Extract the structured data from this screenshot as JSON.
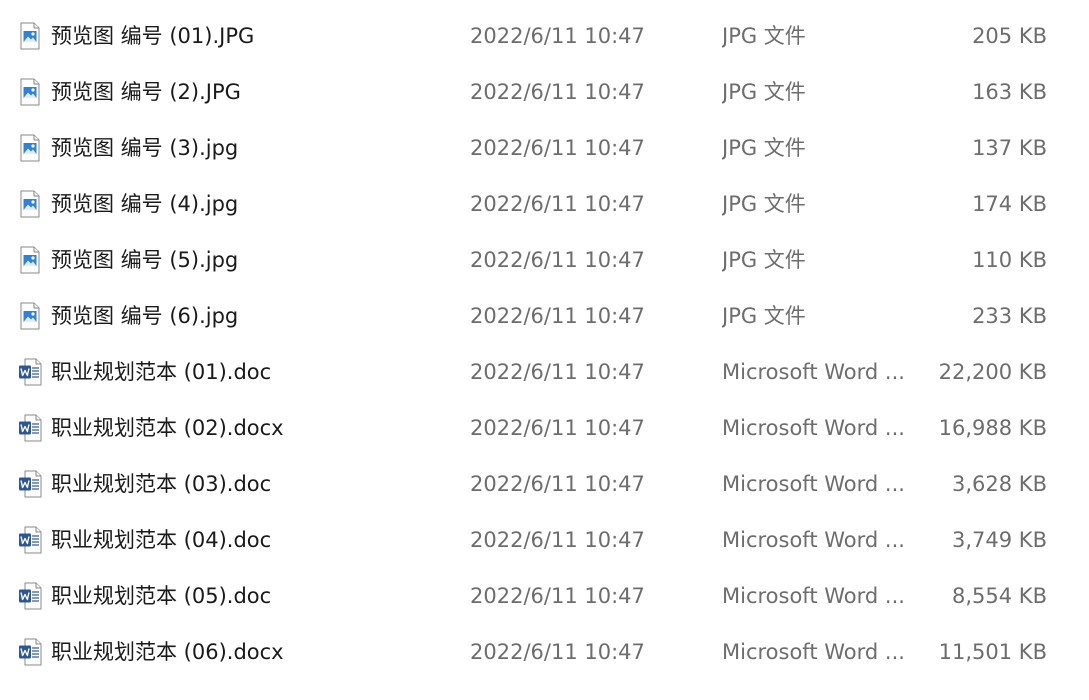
{
  "files": [
    {
      "name": "预览图 编号 (01).JPG",
      "modified": "2022/6/11 10:47",
      "type": "JPG 文件",
      "size": "205 KB",
      "icon": "image-file-icon"
    },
    {
      "name": "预览图 编号 (2).JPG",
      "modified": "2022/6/11 10:47",
      "type": "JPG 文件",
      "size": "163 KB",
      "icon": "image-file-icon"
    },
    {
      "name": "预览图 编号 (3).jpg",
      "modified": "2022/6/11 10:47",
      "type": "JPG 文件",
      "size": "137 KB",
      "icon": "image-file-icon"
    },
    {
      "name": "预览图 编号 (4).jpg",
      "modified": "2022/6/11 10:47",
      "type": "JPG 文件",
      "size": "174 KB",
      "icon": "image-file-icon"
    },
    {
      "name": "预览图 编号 (5).jpg",
      "modified": "2022/6/11 10:47",
      "type": "JPG 文件",
      "size": "110 KB",
      "icon": "image-file-icon"
    },
    {
      "name": "预览图 编号 (6).jpg",
      "modified": "2022/6/11 10:47",
      "type": "JPG 文件",
      "size": "233 KB",
      "icon": "image-file-icon"
    },
    {
      "name": "职业规划范本 (01).doc",
      "modified": "2022/6/11 10:47",
      "type": "Microsoft Word ...",
      "size": "22,200 KB",
      "icon": "word-doc-icon"
    },
    {
      "name": "职业规划范本 (02).docx",
      "modified": "2022/6/11 10:47",
      "type": "Microsoft Word ...",
      "size": "16,988 KB",
      "icon": "word-doc-icon"
    },
    {
      "name": "职业规划范本 (03).doc",
      "modified": "2022/6/11 10:47",
      "type": "Microsoft Word ...",
      "size": "3,628 KB",
      "icon": "word-doc-icon"
    },
    {
      "name": "职业规划范本 (04).doc",
      "modified": "2022/6/11 10:47",
      "type": "Microsoft Word ...",
      "size": "3,749 KB",
      "icon": "word-doc-icon"
    },
    {
      "name": "职业规划范本 (05).doc",
      "modified": "2022/6/11 10:47",
      "type": "Microsoft Word ...",
      "size": "8,554 KB",
      "icon": "word-doc-icon"
    },
    {
      "name": "职业规划范本 (06).docx",
      "modified": "2022/6/11 10:47",
      "type": "Microsoft Word ...",
      "size": "11,501 KB",
      "icon": "word-doc-icon"
    }
  ],
  "colors": {
    "name_text": "#1a1a1a",
    "detail_text": "#6d6d6d",
    "word_blue": "#2b579a",
    "image_blue": "#2f83d6"
  }
}
